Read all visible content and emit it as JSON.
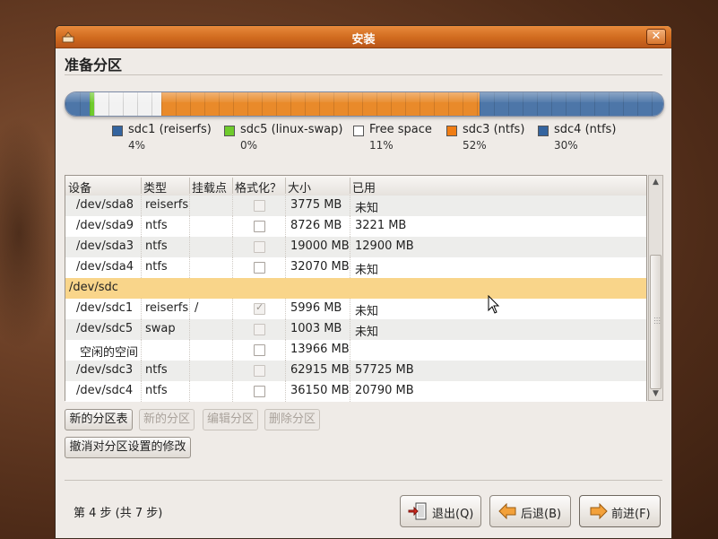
{
  "window": {
    "title": "安装",
    "close_glyph": "✕"
  },
  "heading": "准备分区",
  "bar": {
    "segments": [
      {
        "name": "sdc1",
        "percent": 4,
        "color": "#4d76a8"
      },
      {
        "name": "sdc5",
        "percent": 0.6,
        "color": "#6fcb2c"
      },
      {
        "name": "free",
        "percent": 11,
        "color": "#f2f2f2"
      },
      {
        "name": "sdc3",
        "percent": 52,
        "color": "#e98a2a"
      },
      {
        "name": "sdc4",
        "percent": 30,
        "color": "#4d76a8"
      }
    ]
  },
  "legend": [
    {
      "name": "sdc1 (reiserfs)",
      "pct": "4%",
      "color": "#34649f"
    },
    {
      "name": "sdc5 (linux-swap)",
      "pct": "0%",
      "color": "#6fcb2c"
    },
    {
      "name": "Free space",
      "pct": "11%",
      "color": "#ffffff"
    },
    {
      "name": "sdc3 (ntfs)",
      "pct": "52%",
      "color": "#f07d14"
    },
    {
      "name": "sdc4 (ntfs)",
      "pct": "30%",
      "color": "#34649f"
    }
  ],
  "table": {
    "headers": [
      "设备",
      "类型",
      "挂载点",
      "格式化？",
      "大小",
      "已用"
    ],
    "rows": [
      {
        "device": "/dev/sda8",
        "type": "reiserfs",
        "mount": "",
        "format": "disabled",
        "size": "3775 MB",
        "used": "未知"
      },
      {
        "device": "/dev/sda9",
        "type": "ntfs",
        "mount": "",
        "format": "unchecked",
        "size": "8726 MB",
        "used": "3221 MB"
      },
      {
        "device": "/dev/sda3",
        "type": "ntfs",
        "mount": "",
        "format": "disabled",
        "size": "19000 MB",
        "used": "12900 MB"
      },
      {
        "device": "/dev/sda4",
        "type": "ntfs",
        "mount": "",
        "format": "unchecked",
        "size": "32070 MB",
        "used": "未知"
      },
      {
        "device": "/dev/sdc",
        "type": "",
        "mount": "",
        "format": "none",
        "size": "",
        "used": "",
        "selected": true,
        "disk": true
      },
      {
        "device": "/dev/sdc1",
        "type": "reiserfs",
        "mount": "/",
        "format": "checked",
        "size": "5996 MB",
        "used": "未知"
      },
      {
        "device": "/dev/sdc5",
        "type": "swap",
        "mount": "",
        "format": "disabled",
        "size": "1003 MB",
        "used": "未知"
      },
      {
        "device": "空闲的空间",
        "type": "",
        "mount": "",
        "format": "unchecked",
        "size": "13966 MB",
        "used": ""
      },
      {
        "device": "/dev/sdc3",
        "type": "ntfs",
        "mount": "",
        "format": "disabled",
        "size": "62915 MB",
        "used": "57725 MB"
      },
      {
        "device": "/dev/sdc4",
        "type": "ntfs",
        "mount": "",
        "format": "unchecked",
        "size": "36150 MB",
        "used": "20790 MB"
      }
    ]
  },
  "actions": {
    "new_table": "新的分区表",
    "new_partition": "新的分区",
    "edit_partition": "编辑分区",
    "delete_partition": "删除分区",
    "undo": "撤消对分区设置的修改"
  },
  "footer": {
    "step": "第 4 步 (共 7 步)",
    "quit": "退出(Q)",
    "back": "后退(B)",
    "forward": "前进(F)"
  },
  "colors": {
    "selected_row": "#f9d58a",
    "titlebar": "#d06a1e"
  }
}
